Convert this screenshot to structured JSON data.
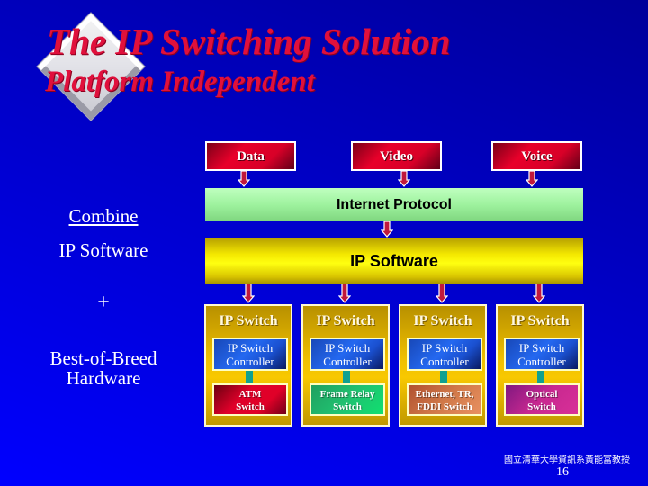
{
  "slide": {
    "title_line1": "The IP Switching Solution",
    "title_line2": "Platform Independent",
    "logo_icon": "diamond-icon"
  },
  "left": {
    "combine": "Combine",
    "ip_software": "IP Software",
    "plus": "+",
    "hardware": "Best-of-Breed Hardware"
  },
  "sources": [
    "Data",
    "Video",
    "Voice"
  ],
  "layers": {
    "protocol": "Internet Protocol",
    "software": "IP Software"
  },
  "switches": [
    {
      "head": "IP Switch",
      "controller": "IP Switch Controller",
      "hardware": "ATM Switch",
      "hardware_color": "#e0002a"
    },
    {
      "head": "IP Switch",
      "controller": "IP Switch Controller",
      "hardware": "Frame Relay Switch",
      "hardware_color": "#20c070"
    },
    {
      "head": "IP Switch",
      "controller": "IP Switch Controller",
      "hardware": "Ethernet, TR, FDDI Switch",
      "hardware_color": "#d07848"
    },
    {
      "head": "IP Switch",
      "controller": "IP Switch Controller",
      "hardware": "Optical Switch",
      "hardware_color": "#c82890"
    }
  ],
  "footer": {
    "credit": "國立清華大學資訊系黃能富教授",
    "page_number": "16"
  },
  "colors": {
    "title": "#e0103c",
    "background": "#0000ff",
    "protocol_bar": "#9ef29e",
    "software_bar": "#f4e800",
    "switch_column": "#f0c000",
    "controller": "#2468f0",
    "arrow": "#c0183c"
  }
}
